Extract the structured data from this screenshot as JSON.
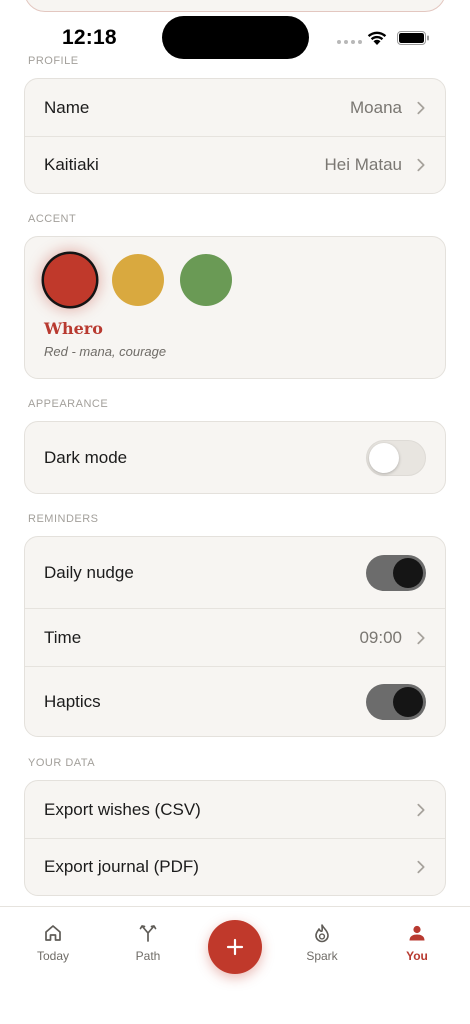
{
  "status_bar": {
    "time": "12:18"
  },
  "sections": {
    "profile": "PROFILE",
    "accent": "ACCENT",
    "appearance": "APPEARANCE",
    "reminders": "REMINDERS",
    "your_data": "YOUR DATA"
  },
  "profile": {
    "name_label": "Name",
    "name_value": "Moana",
    "kaitiaki_label": "Kaitiaki",
    "kaitiaki_value": "Hei Matau"
  },
  "accent": {
    "swatches": [
      {
        "name": "red",
        "color": "#c0392b",
        "selected": true
      },
      {
        "name": "yellow",
        "color": "#d9a93f",
        "selected": false
      },
      {
        "name": "green",
        "color": "#6a9a55",
        "selected": false
      }
    ],
    "selected_name": "Whero",
    "selected_desc": "Red - mana, courage"
  },
  "appearance": {
    "dark_mode_label": "Dark mode",
    "dark_mode_on": false
  },
  "reminders": {
    "daily_nudge_label": "Daily nudge",
    "daily_nudge_on": true,
    "time_label": "Time",
    "time_value": "09:00",
    "haptics_label": "Haptics",
    "haptics_on": true
  },
  "your_data": {
    "export_csv_label": "Export wishes (CSV)",
    "export_pdf_label": "Export journal (PDF)"
  },
  "tab_bar": {
    "today": "Today",
    "path": "Path",
    "spark": "Spark",
    "you": "You",
    "active": "you",
    "accent_color": "#b83a30"
  }
}
